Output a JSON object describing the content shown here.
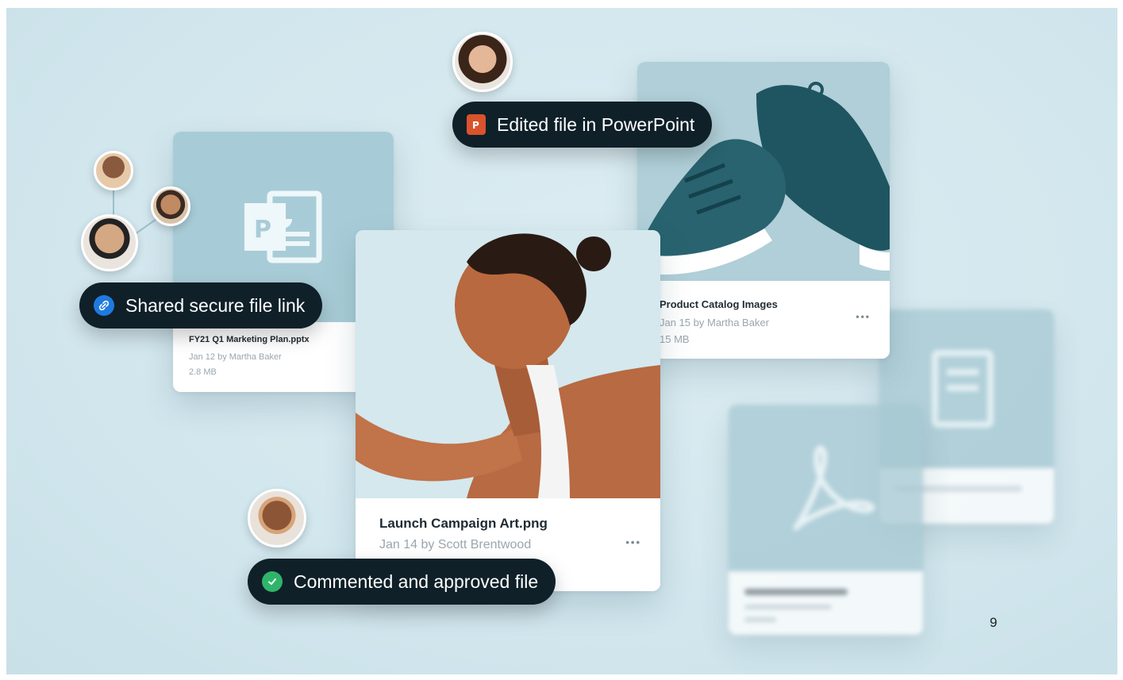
{
  "pills": {
    "shared": "Shared secure file link",
    "edited": "Edited file in PowerPoint",
    "approved": "Commented and approved file"
  },
  "cards": {
    "marketing": {
      "name": "FY21 Q1 Marketing Plan.pptx",
      "date": "Jan 12 by Martha Baker",
      "size": "2.8 MB",
      "menu": "•••"
    },
    "catalog": {
      "name": "Product Catalog Images",
      "date": "Jan 15 by Martha Baker",
      "size": "15 MB",
      "menu": "•••"
    },
    "campaign": {
      "name": "Launch Campaign Art.png",
      "date": "Jan 14 by Scott Brentwood",
      "menu": "•••"
    }
  },
  "page_number": "9",
  "colors": {
    "accent_link": "#1f7ae0",
    "accent_approved": "#2fb56a",
    "powerpoint": "#d9532c",
    "pill_bg": "#0f2029"
  },
  "icons": [
    "powerpoint-file-icon",
    "pdf-file-icon",
    "link-icon",
    "powerpoint-icon",
    "checkmark-icon",
    "more-options-icon"
  ]
}
